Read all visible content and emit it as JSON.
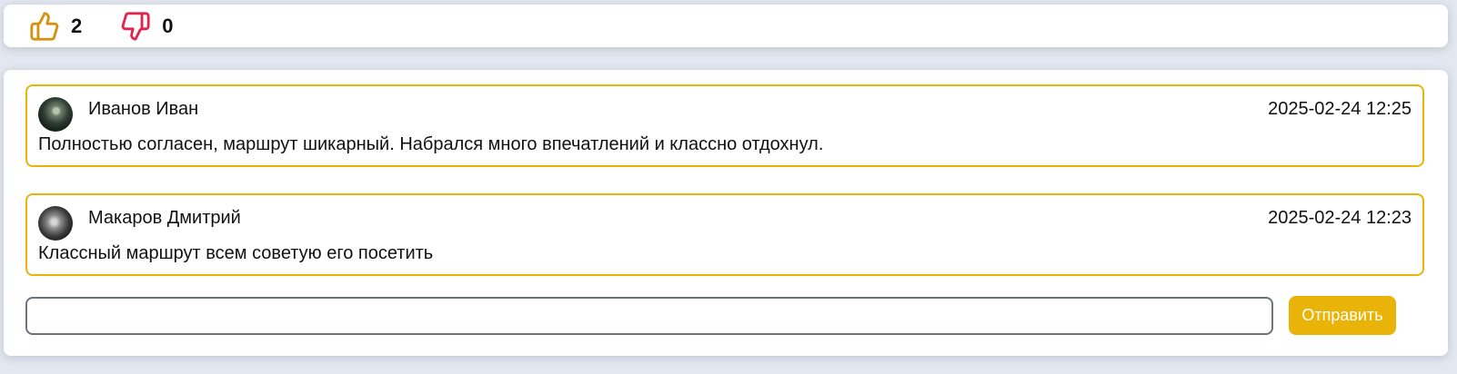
{
  "reactions": {
    "likes": {
      "icon": "thumbs-up-icon",
      "color": "#d4920f",
      "count": "2"
    },
    "dislikes": {
      "icon": "thumbs-down-icon",
      "color": "#e0244f",
      "count": "0"
    }
  },
  "comments": [
    {
      "author": "Иванов Иван",
      "date": "2025-02-24 12:25",
      "text": "Полностью согласен, маршрут шикарный. Набрался много впечатлений и классно отдохнул."
    },
    {
      "author": "Макаров Дмитрий",
      "date": "2025-02-24 12:23",
      "text": "Классный маршрут всем советую его посетить"
    }
  ],
  "form": {
    "input_value": "",
    "input_placeholder": "",
    "send_label": "Отправить"
  },
  "colors": {
    "accent": "#eab308",
    "background": "#e3e7ef",
    "input_border": "#6b7280"
  }
}
